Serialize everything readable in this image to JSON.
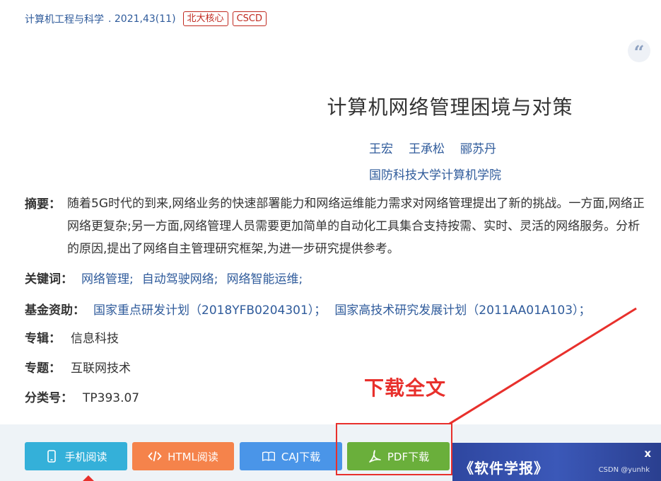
{
  "header": {
    "journal": "计算机工程与科学",
    "issue": ". 2021,43(11)",
    "badges": [
      "北大核心",
      "CSCD"
    ]
  },
  "cite_icon": "quote-icon",
  "article": {
    "title": "计算机网络管理困境与对策",
    "authors": [
      "王宏",
      "王承松",
      "郦苏丹"
    ],
    "affiliation": "国防科技大学计算机学院"
  },
  "abstract": {
    "label": "摘要：",
    "lines": [
      "随着5G时代的到来,网络业务的快速部署能力和网络运维能力需求对网络管理提出了新的挑战。一方面,网络正",
      "网络更复杂;另一方面,网络管理人员需要更加简单的自动化工具集合支持按需、实时、灵活的网络服务。分析",
      "的原因,提出了网络自主管理研究框架,为进一步研究提供参考。"
    ]
  },
  "keywords": {
    "label": "关键词：",
    "items": [
      "网络管理;",
      "自动驾驶网络;",
      "网络智能运维;"
    ]
  },
  "funding": {
    "label": "基金资助：",
    "items": [
      "国家重点研发计划（2018YFB0204301）；",
      "国家高技术研究发展计划（2011AA01A103）；"
    ]
  },
  "album": {
    "label": "专辑：",
    "value": "信息科技"
  },
  "topic": {
    "label": "专题：",
    "value": "互联网技术"
  },
  "classification": {
    "label": "分类号：",
    "value": "TP393.07"
  },
  "annotation": {
    "text": "下载全文",
    "color": "#e8302c"
  },
  "actions": {
    "mobile": "手机阅读",
    "html": "HTML阅读",
    "caj": "CAJ下载",
    "pdf": "PDF下载"
  },
  "ad": {
    "text": "《软件学报》",
    "close": "x",
    "watermark": "CSDN @yunhk"
  }
}
